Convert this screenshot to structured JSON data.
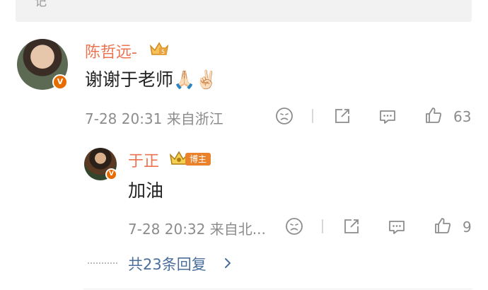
{
  "top_quote": {
    "text": "记"
  },
  "comment": {
    "username": "陈哲远-",
    "content": "谢谢于老师🙏🏻✌🏻",
    "timestamp": "7-28 20:31",
    "location": "来自浙江",
    "like_count": "63"
  },
  "reply": {
    "username": "于正",
    "badge": "博主",
    "content": "加油",
    "timestamp": "7-28 20:32",
    "location": "来自北...",
    "like_count": "9"
  },
  "more_replies": {
    "label": "共23条回复"
  },
  "colors": {
    "username": "#eb7350",
    "link": "#4a6e9c",
    "meta": "#8c8c8c",
    "verified": "#e86b00"
  },
  "icons": [
    "dislike-icon",
    "share-icon",
    "comment-icon",
    "like-icon",
    "crown-icon",
    "chevron-right-icon",
    "verified-icon"
  ]
}
